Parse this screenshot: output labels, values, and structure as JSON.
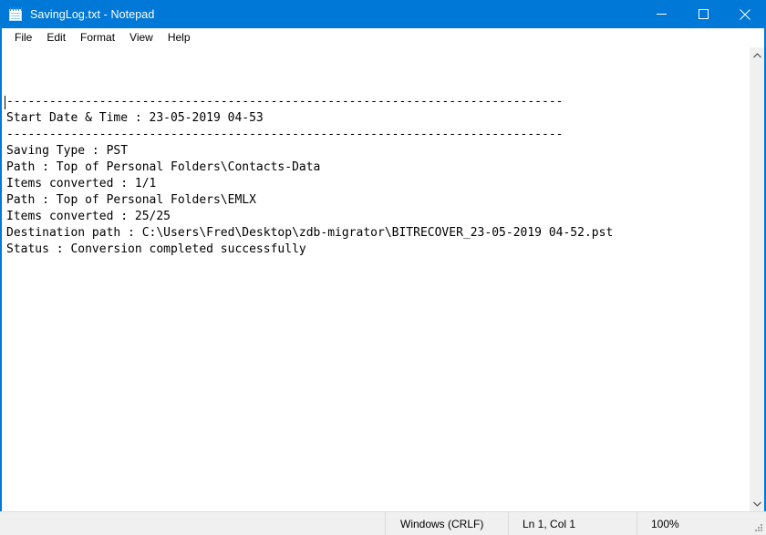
{
  "window": {
    "title": "SavingLog.txt - Notepad",
    "icon": "notepad-icon",
    "accent_color": "#0078d7",
    "controls": {
      "minimize": "Minimize",
      "maximize": "Maximize",
      "close": "Close"
    }
  },
  "menubar": {
    "items": [
      {
        "label": "File"
      },
      {
        "label": "Edit"
      },
      {
        "label": "Format"
      },
      {
        "label": "View"
      },
      {
        "label": "Help"
      }
    ]
  },
  "editor": {
    "content": "------------------------------------------------------------------------------\nStart Date & Time : 23-05-2019 04-53\n------------------------------------------------------------------------------\nSaving Type : PST\nPath : Top of Personal Folders\\Contacts-Data\nItems converted : 1/1\nPath : Top of Personal Folders\\EMLX\nItems converted : 25/25\nDestination path : C:\\Users\\Fred\\Desktop\\zdb-migrator\\BITRECOVER_23-05-2019 04-52.pst\nStatus : Conversion completed successfully",
    "lines": [
      "------------------------------------------------------------------------------",
      "Start Date & Time : 23-05-2019 04-53",
      "------------------------------------------------------------------------------",
      "Saving Type : PST",
      "Path : Top of Personal Folders\\Contacts-Data",
      "Items converted : 1/1",
      "Path : Top of Personal Folders\\EMLX",
      "Items converted : 25/25",
      "Destination path : C:\\Users\\Fred\\Desktop\\zdb-migrator\\BITRECOVER_23-05-2019 04-52.pst",
      "Status : Conversion completed successfully"
    ],
    "text_color": "#000000",
    "background_color": "#ffffff"
  },
  "scrollbar": {
    "up_arrow": "scroll-up-icon",
    "down_arrow": "scroll-down-icon"
  },
  "statusbar": {
    "blank": "",
    "line_ending": "Windows (CRLF)",
    "position": "Ln 1, Col 1",
    "zoom": "100%"
  }
}
